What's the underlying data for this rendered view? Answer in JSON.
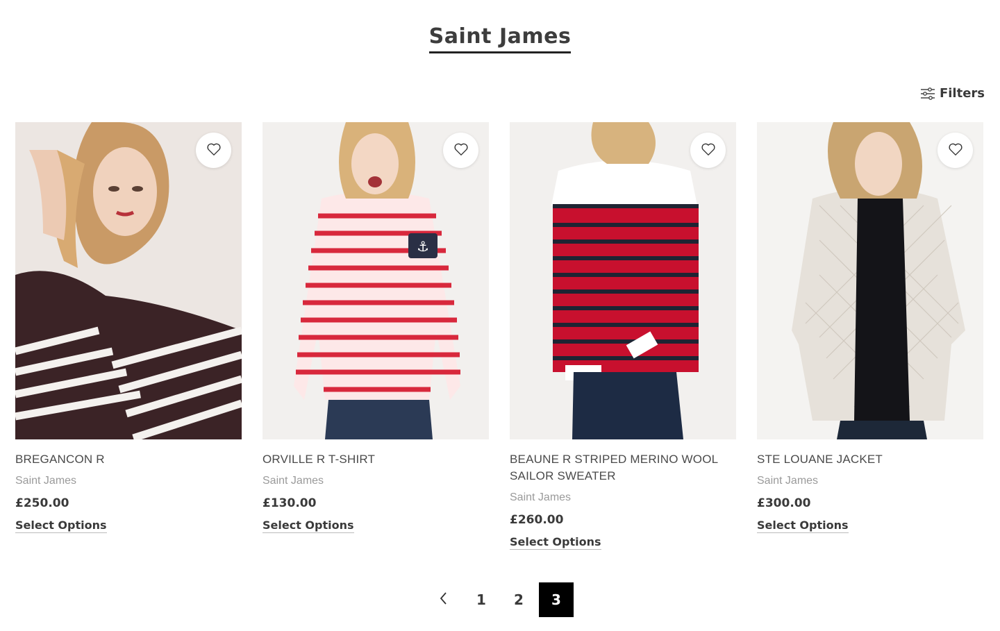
{
  "page": {
    "title": "Saint James"
  },
  "toolbar": {
    "filters_label": "Filters",
    "filters_icon": "sliders-icon"
  },
  "products": [
    {
      "name": "BREGANCON R",
      "brand": "Saint James",
      "price": "£250.00",
      "action": "Select Options"
    },
    {
      "name": "ORVILLE R T-SHIRT",
      "brand": "Saint James",
      "price": "£130.00",
      "action": "Select Options"
    },
    {
      "name": "BEAUNE R STRIPED MERINO WOOL SAILOR SWEATER",
      "brand": "Saint James",
      "price": "£260.00",
      "action": "Select Options"
    },
    {
      "name": "STE LOUANE JACKET",
      "brand": "Saint James",
      "price": "£300.00",
      "action": "Select Options"
    }
  ],
  "pagination": {
    "prev_icon": "chevron-left-icon",
    "pages": [
      "1",
      "2",
      "3"
    ],
    "current": "3"
  }
}
